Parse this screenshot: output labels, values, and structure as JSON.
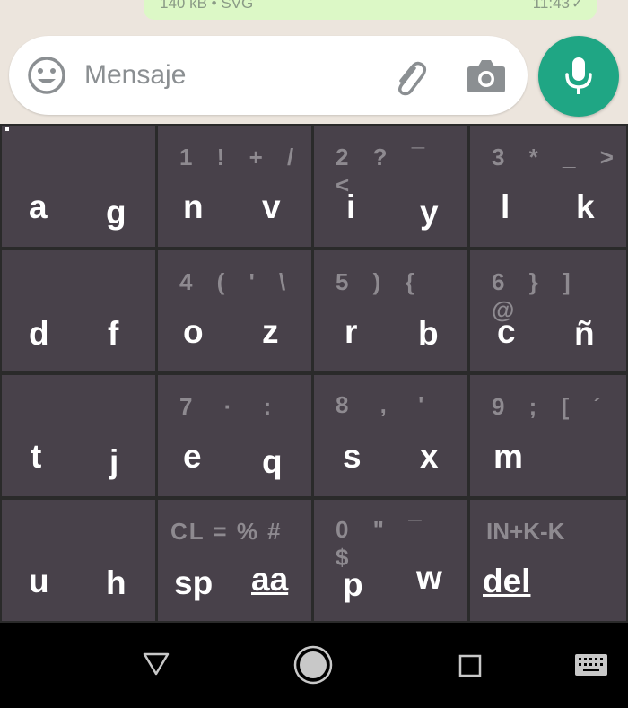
{
  "message": {
    "meta": "140 kB • SVG",
    "time": "11:43",
    "status_icon": "check-icon"
  },
  "composer": {
    "placeholder": "Mensaje"
  },
  "icons": {
    "emoji": "emoji-icon",
    "attach": "paperclip-icon",
    "camera": "camera-icon",
    "mic": "microphone-icon"
  },
  "colors": {
    "accent": "#1fa684",
    "key_bg": "#48414a",
    "secondary_symbol": "#8e8a90",
    "bubble": "#dcf8c6"
  },
  "keyboard": {
    "rows": [
      [
        {
          "symbols": "",
          "left": "a",
          "right": "g"
        },
        {
          "symbols": "1 ! + /",
          "left": "n",
          "right": "v"
        },
        {
          "symbols": "2 ? ¯ <",
          "left": "i",
          "right": "y"
        },
        {
          "symbols": "3 * _ >",
          "left": "l",
          "right": "k"
        }
      ],
      [
        {
          "symbols": "",
          "left": "d",
          "right": "f"
        },
        {
          "symbols": "4 ( ' \\",
          "left": "o",
          "right": "z"
        },
        {
          "symbols": "5 ) {",
          "left": "r",
          "right": "b"
        },
        {
          "symbols": "6 } ] @",
          "left": "c",
          "right": "ñ"
        }
      ],
      [
        {
          "symbols": "",
          "left": "t",
          "right": "j"
        },
        {
          "symbols": "7 · :",
          "left": "e",
          "right": "q"
        },
        {
          "symbols": "8 , '",
          "left": "s",
          "right": "x"
        },
        {
          "symbols": "9 ; [ ´",
          "left": "m",
          "right": ""
        }
      ],
      [
        {
          "symbols": "",
          "left": "u",
          "right": "h"
        },
        {
          "symbols": "CL = % #",
          "left": "sp",
          "right": "aa"
        },
        {
          "symbols": "0 \" ¯ $",
          "left": "p",
          "right": "w"
        },
        {
          "symbols": "IN+K-K",
          "left": "del",
          "right": ""
        }
      ]
    ]
  },
  "navbar": {
    "back": "back-triangle-icon",
    "home": "home-circle-icon",
    "recents": "recents-square-icon",
    "keyboard": "keyboard-icon"
  }
}
